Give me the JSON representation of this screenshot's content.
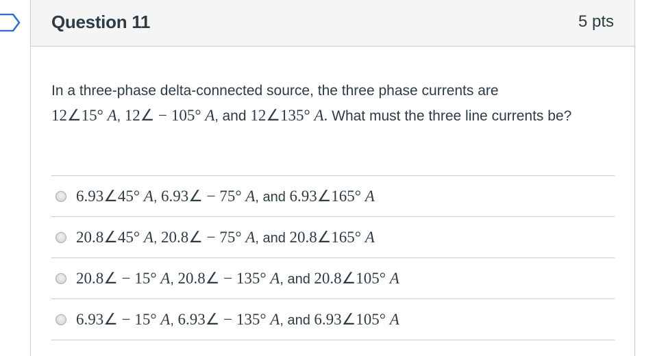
{
  "question": {
    "title": "Question 11",
    "points": "5 pts",
    "text_intro": "In a three-phase delta-connected source, the three phase currents are",
    "phase_current_1": "12∠15° ",
    "phase_current_2": "12∠ − 105° ",
    "phase_current_3": "12∠135° ",
    "unit": "A",
    "and_word": "and",
    "text_outro": "What must the three line currents be?"
  },
  "answers": [
    {
      "c1": "6.93∠45° ",
      "c2": "6.93∠ − 75° ",
      "c3": "6.93∠165° "
    },
    {
      "c1": "20.8∠45° ",
      "c2": "20.8∠ − 75° ",
      "c3": "20.8∠165° "
    },
    {
      "c1": "20.8∠ − 15° ",
      "c2": "20.8∠ − 135° ",
      "c3": "20.8∠105° "
    },
    {
      "c1": "6.93∠ − 15° ",
      "c2": "6.93∠ − 135° ",
      "c3": "6.93∠105° "
    }
  ],
  "icons": {
    "flag": "flag-question-icon",
    "radio": "radio-button-icon"
  },
  "colors": {
    "text": "#2d3b45",
    "border": "#c7cdd1",
    "header_bg": "#f5f5f5",
    "flag": "#2d6bcf"
  }
}
